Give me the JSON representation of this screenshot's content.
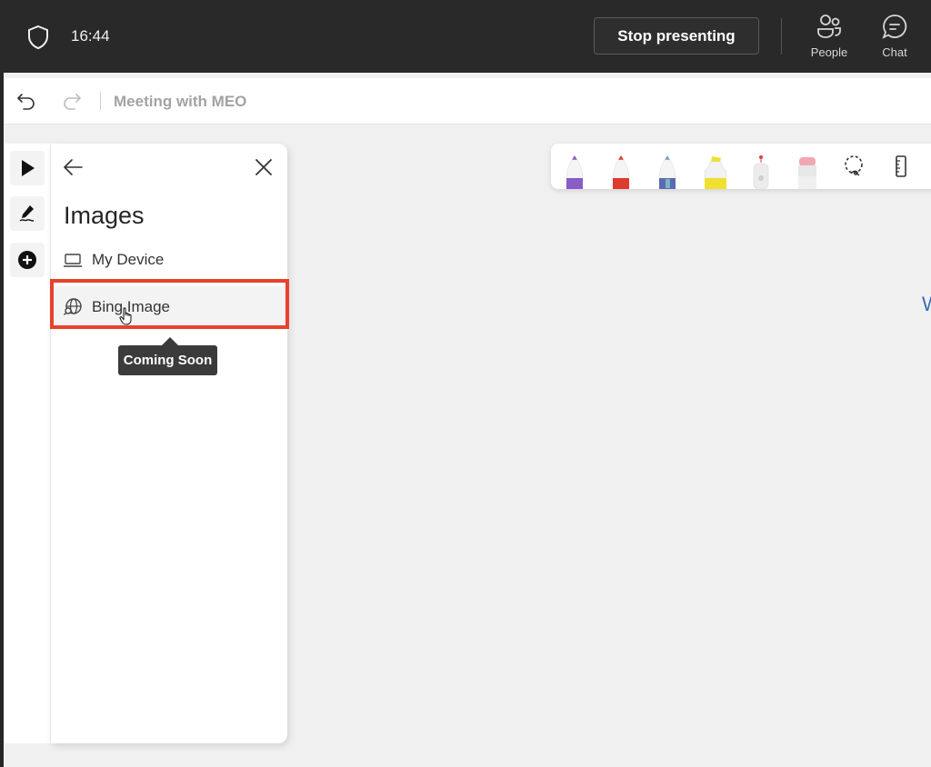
{
  "meeting_bar": {
    "time": "16:44",
    "stop_presenting_label": "Stop presenting",
    "people_label": "People",
    "chat_label": "Chat"
  },
  "whiteboard": {
    "title": "Meeting with MEO",
    "canvas_partial_text": "W"
  },
  "tool_rail": {
    "items": [
      {
        "name": "select",
        "icon": "cursor-arrow-icon"
      },
      {
        "name": "inking",
        "icon": "pen-signature-icon"
      },
      {
        "name": "add",
        "icon": "plus-circle-icon"
      }
    ]
  },
  "images_panel": {
    "title": "Images",
    "items": [
      {
        "label": "My Device",
        "icon": "laptop-icon"
      },
      {
        "label": "Bing Image",
        "icon": "globe-search-icon"
      }
    ],
    "tooltip": "Coming Soon"
  },
  "pen_toolbar": {
    "pens": [
      {
        "name": "purple-pen",
        "color": "#8a5cc6"
      },
      {
        "name": "red-pen",
        "color": "#e0392f"
      },
      {
        "name": "galaxy-pen",
        "color": "#5a6bb0"
      },
      {
        "name": "yellow-highlighter",
        "color": "#f0e030"
      },
      {
        "name": "laser-pointer",
        "color": "#e04040"
      },
      {
        "name": "eraser",
        "color": "#f0a8b0"
      }
    ],
    "tools": [
      {
        "name": "lasso",
        "icon": "lasso-icon"
      },
      {
        "name": "ruler",
        "icon": "ruler-icon"
      }
    ]
  },
  "colors": {
    "accent_highlight": "#e8412c",
    "topbar_bg": "#292929"
  }
}
